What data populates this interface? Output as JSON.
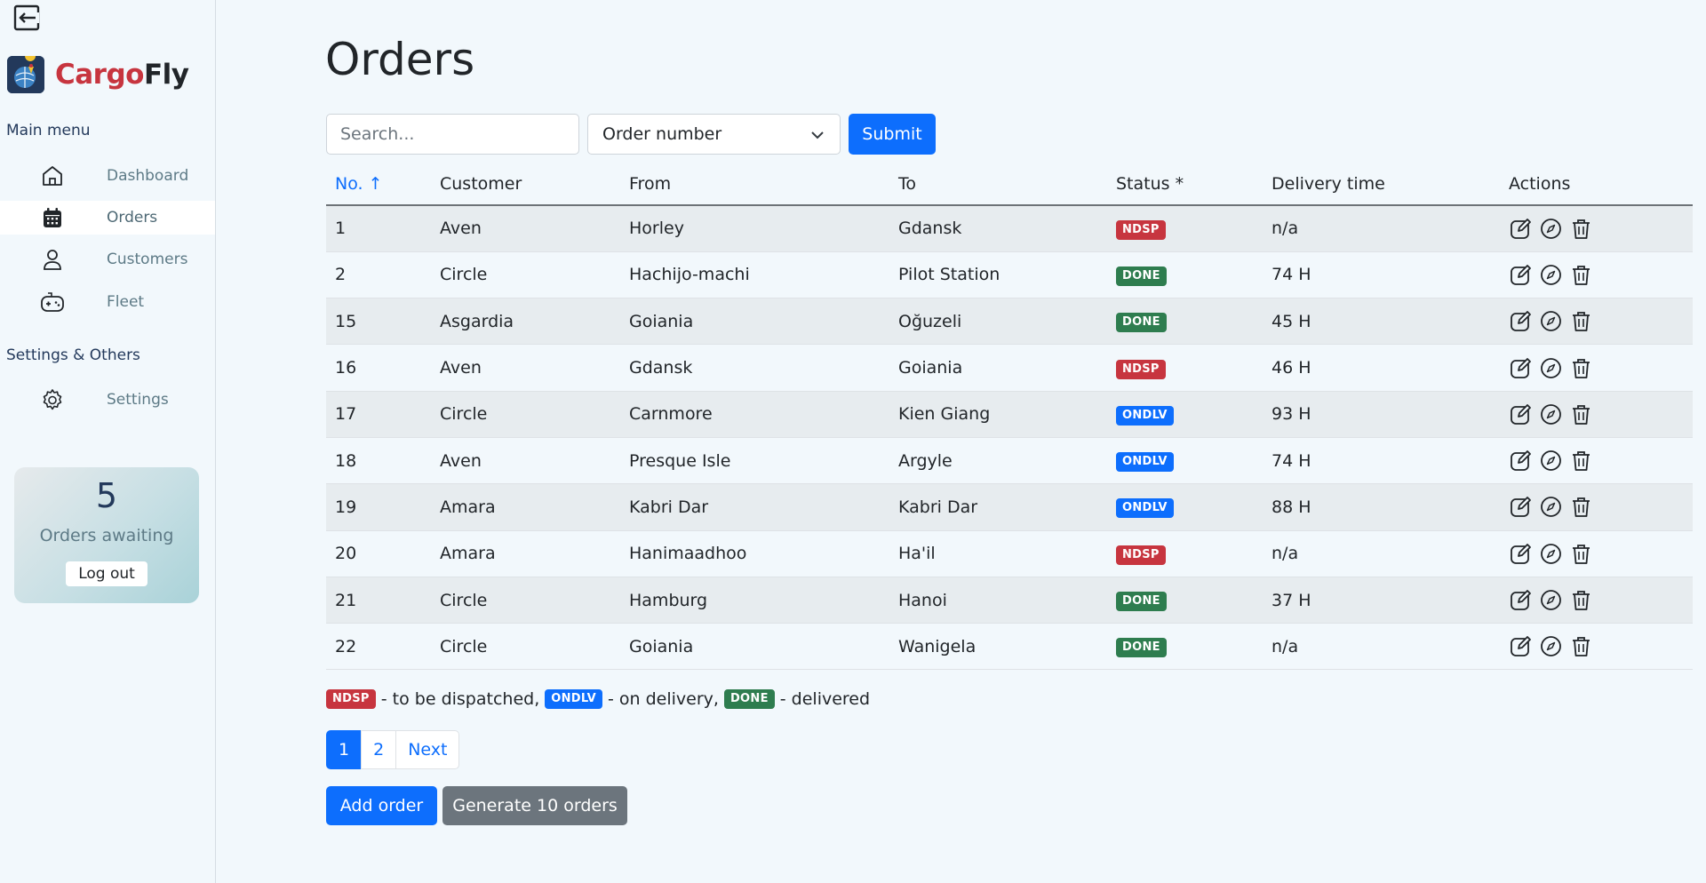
{
  "brand": {
    "name_part1": "Cargo",
    "name_part2": "Fly"
  },
  "sidebar": {
    "main_menu_title": "Main menu",
    "items": [
      {
        "label": "Dashboard",
        "icon": "home-icon"
      },
      {
        "label": "Orders",
        "icon": "calendar-icon",
        "active": true
      },
      {
        "label": "Customers",
        "icon": "user-icon"
      },
      {
        "label": "Fleet",
        "icon": "gamepad-icon"
      }
    ],
    "settings_title": "Settings & Others",
    "settings_item": {
      "label": "Settings",
      "icon": "gear-icon"
    },
    "awaiting": {
      "count": "5",
      "label": "Orders awaiting",
      "logout_label": "Log out"
    }
  },
  "main": {
    "title": "Orders",
    "search": {
      "placeholder": "Search...",
      "value": ""
    },
    "filter": {
      "selected": "Order number"
    },
    "submit_label": "Submit",
    "table": {
      "headers": [
        "No. ↑",
        "Customer",
        "From",
        "To",
        "Status *",
        "Delivery time",
        "Actions"
      ],
      "rows": [
        {
          "no": "1",
          "customer": "Aven",
          "from": "Horley",
          "to": "Gdansk",
          "status": "NDSP",
          "delivery": "n/a"
        },
        {
          "no": "2",
          "customer": "Circle",
          "from": "Hachijo-machi",
          "to": "Pilot Station",
          "status": "DONE",
          "delivery": "74 H"
        },
        {
          "no": "15",
          "customer": "Asgardia",
          "from": "Goiania",
          "to": "Oğuzeli",
          "status": "DONE",
          "delivery": "45 H"
        },
        {
          "no": "16",
          "customer": "Aven",
          "from": "Gdansk",
          "to": "Goiania",
          "status": "NDSP",
          "delivery": "46 H"
        },
        {
          "no": "17",
          "customer": "Circle",
          "from": "Carnmore",
          "to": "Kien Giang",
          "status": "ONDLV",
          "delivery": "93 H"
        },
        {
          "no": "18",
          "customer": "Aven",
          "from": "Presque Isle",
          "to": "Argyle",
          "status": "ONDLV",
          "delivery": "74 H"
        },
        {
          "no": "19",
          "customer": "Amara",
          "from": "Kabri Dar",
          "to": "Kabri Dar",
          "status": "ONDLV",
          "delivery": "88 H"
        },
        {
          "no": "20",
          "customer": "Amara",
          "from": "Hanimaadhoo",
          "to": "Ha'il",
          "status": "NDSP",
          "delivery": "n/a"
        },
        {
          "no": "21",
          "customer": "Circle",
          "from": "Hamburg",
          "to": "Hanoi",
          "status": "DONE",
          "delivery": "37 H"
        },
        {
          "no": "22",
          "customer": "Circle",
          "from": "Goiania",
          "to": "Wanigela",
          "status": "DONE",
          "delivery": "n/a"
        }
      ]
    },
    "status_colors": {
      "NDSP": "#c7353f",
      "ONDLV": "#0d6efd",
      "DONE": "#2e7d4f"
    },
    "legend": [
      {
        "badge": "NDSP",
        "text": "- to be dispatched,"
      },
      {
        "badge": "ONDLV",
        "text": "- on delivery,"
      },
      {
        "badge": "DONE",
        "text": "- delivered"
      }
    ],
    "pagination": {
      "pages": [
        "1",
        "2"
      ],
      "current": "1",
      "next_label": "Next"
    },
    "add_order_label": "Add order",
    "generate_label": "Generate 10 orders"
  }
}
